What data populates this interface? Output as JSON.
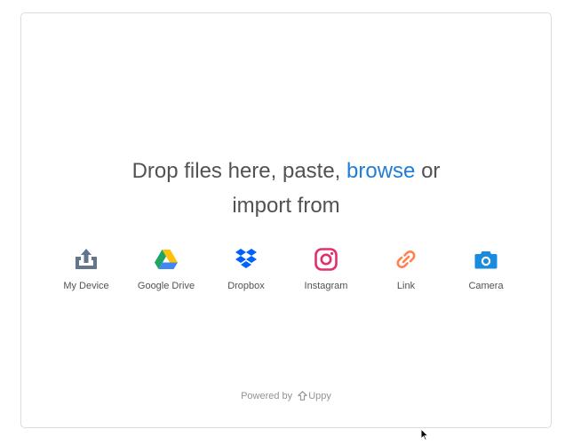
{
  "title": {
    "prefix": "Drop files here, paste,",
    "browse": "browse",
    "suffix": "or import from"
  },
  "sources": [
    {
      "label": "My Device",
      "icon": "my-device-icon",
      "color": "#61768a"
    },
    {
      "label": "Google Drive",
      "icon": "google-drive-icon",
      "color": "#1fa463"
    },
    {
      "label": "Dropbox",
      "icon": "dropbox-icon",
      "color": "#0061fe"
    },
    {
      "label": "Instagram",
      "icon": "instagram-icon",
      "color": "#e1306c"
    },
    {
      "label": "Link",
      "icon": "link-icon",
      "color": "#ff814f"
    },
    {
      "label": "Camera",
      "icon": "camera-icon",
      "color": "#1a8cdf"
    }
  ],
  "footer": {
    "powered_by": "Powered by",
    "brand": "Uppy"
  },
  "colors": {
    "accent": "#1f7ed6",
    "text": "#525252",
    "muted": "#939393",
    "border": "#dcdcdc"
  }
}
